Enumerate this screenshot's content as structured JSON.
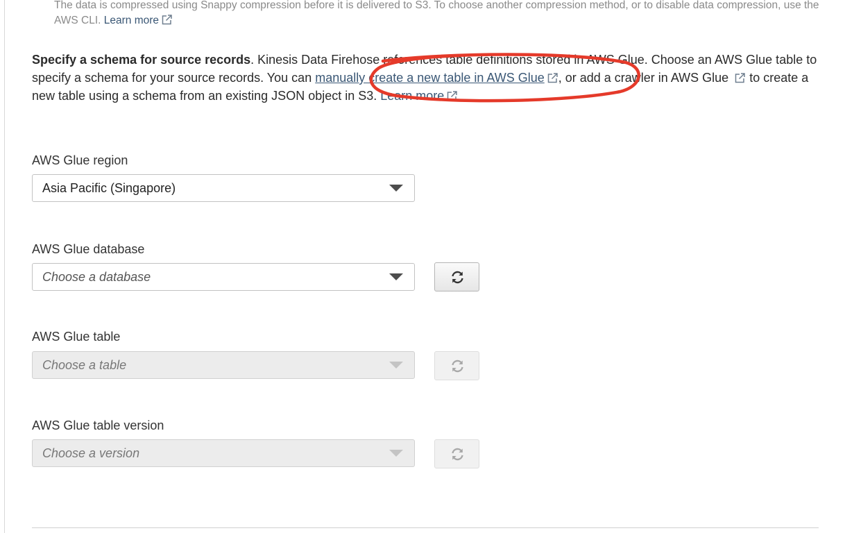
{
  "compression": {
    "text_line": "The data is compressed using Snappy compression before it is delivered to S3. To choose another compression method, or to disable data compression, use the AWS CLI.",
    "learn_more": "Learn more"
  },
  "schema": {
    "bold": "Specify a schema for source records",
    "text1": ". Kinesis Data Firehose references table definitions stored in AWS Glue. Choose an AWS Glue table to specify a schema for your source records. You can ",
    "link_manual": "manually create a new table in AWS Glue",
    "text2": ", or add a crawler in AWS Glue",
    "text3": " to create a new table using a schema from an existing JSON object in S3.",
    "learn_more": "Learn more"
  },
  "fields": {
    "region": {
      "label": "AWS Glue region",
      "value": "Asia Pacific (Singapore)"
    },
    "database": {
      "label": "AWS Glue database",
      "placeholder": "Choose a database"
    },
    "table": {
      "label": "AWS Glue table",
      "placeholder": "Choose a table"
    },
    "version": {
      "label": "AWS Glue table version",
      "placeholder": "Choose a version"
    }
  },
  "icons": {
    "external_link": "external-link-icon",
    "refresh": "refresh-icon",
    "caret": "caret-down-icon"
  },
  "colors": {
    "annotation": "#e53a2a",
    "link": "#3a5775"
  }
}
